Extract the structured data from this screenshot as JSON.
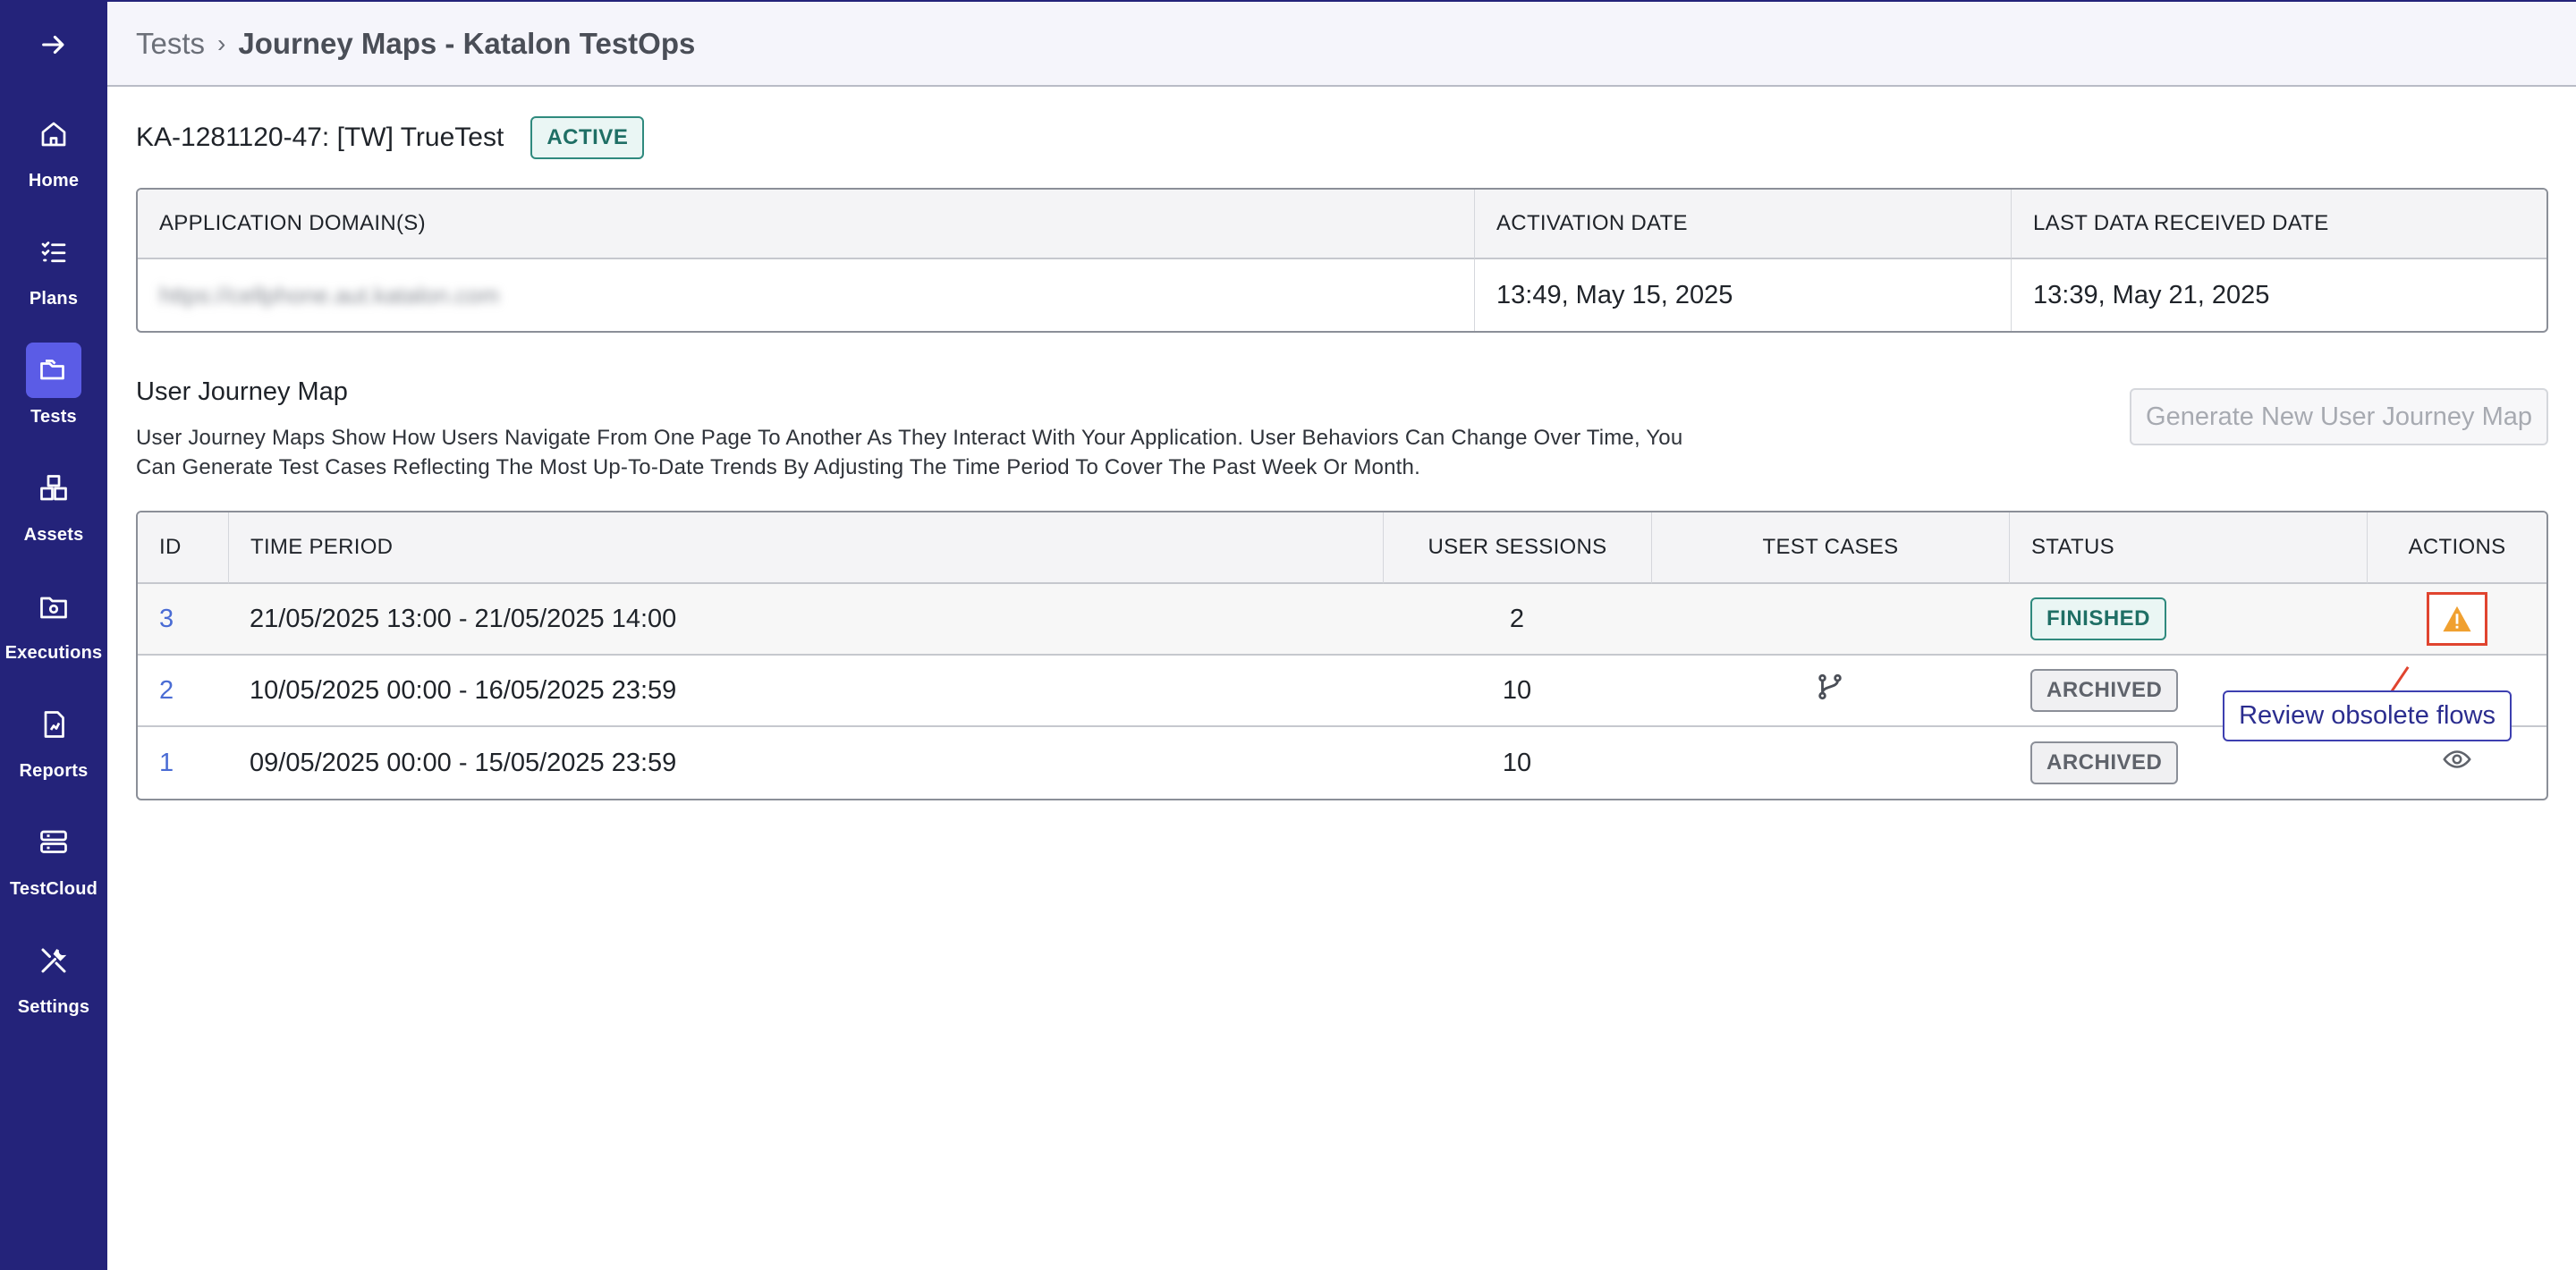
{
  "sidebar": {
    "items": [
      {
        "label": "Home",
        "icon": "home-icon"
      },
      {
        "label": "Plans",
        "icon": "list-check-icon"
      },
      {
        "label": "Tests",
        "icon": "folder-icon",
        "active": true
      },
      {
        "label": "Assets",
        "icon": "boxes-icon"
      },
      {
        "label": "Executions",
        "icon": "folder-gear-icon"
      },
      {
        "label": "Reports",
        "icon": "report-icon"
      },
      {
        "label": "TestCloud",
        "icon": "server-icon"
      },
      {
        "label": "Settings",
        "icon": "tools-icon"
      }
    ]
  },
  "header": {
    "breadcrumb_root": "Tests",
    "breadcrumb_sep": "›",
    "breadcrumb_current": "Journey Maps - Katalon TestOps"
  },
  "project": {
    "title": "KA-1281120-47: [TW] TrueTest",
    "status": "ACTIVE"
  },
  "info_table": {
    "headers": [
      "APPLICATION DOMAIN(S)",
      "ACTIVATION DATE",
      "LAST DATA RECEIVED DATE"
    ],
    "domain_blurred": "https://cellphone.aut.katalon.com",
    "activation_date": "13:49, May 15, 2025",
    "last_data_received": "13:39, May 21, 2025"
  },
  "journey": {
    "title": "User Journey Map",
    "description": "User Journey Maps Show How Users Navigate From One Page To Another As They Interact With Your Application. User Behaviors Can Change Over Time, You Can Generate Test Cases Reflecting The Most Up-To-Date Trends By Adjusting The Time Period To Cover The Past Week Or Month.",
    "generate_label": "Generate New User Journey Map",
    "headers": [
      "ID",
      "TIME PERIOD",
      "USER SESSIONS",
      "TEST CASES",
      "STATUS",
      "ACTIONS"
    ],
    "rows": [
      {
        "id": "3",
        "period": "21/05/2025 13:00 - 21/05/2025 14:00",
        "sessions": "2",
        "status": "FINISHED",
        "action_icon": "warning-icon"
      },
      {
        "id": "2",
        "period": "10/05/2025 00:00 - 16/05/2025 23:59",
        "sessions": "10",
        "test_case_icon": "branch-icon",
        "status": "ARCHIVED"
      },
      {
        "id": "1",
        "period": "09/05/2025 00:00 - 15/05/2025 23:59",
        "sessions": "10",
        "status": "ARCHIVED",
        "action_icon": "eye-icon"
      }
    ],
    "tooltip": "Review obsolete flows"
  },
  "colors": {
    "sidebar_bg": "#24237a",
    "active_nav": "#5b5ce6",
    "link": "#4a6cd4",
    "warning": "#f0a030",
    "highlight_border": "#e0442f"
  }
}
